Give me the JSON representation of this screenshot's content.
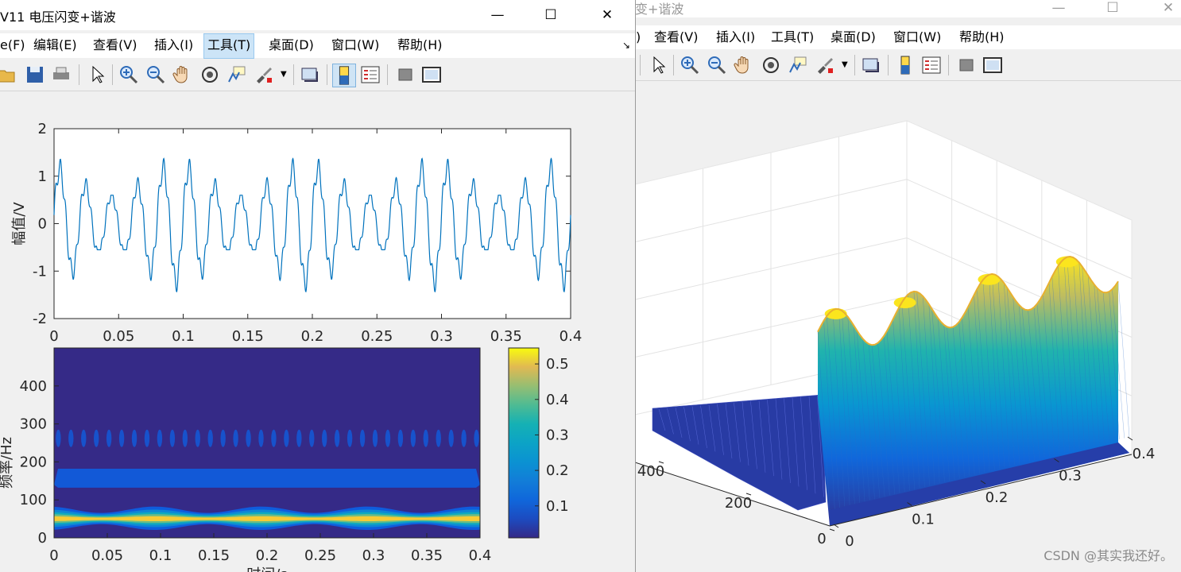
{
  "left_window": {
    "title": "V11 电压闪变+谐波",
    "controls": {
      "minimize": "—",
      "maximize": "☐",
      "close": "✕"
    },
    "menu": [
      "e(F)",
      "编辑(E)",
      "查看(V)",
      "插入(I)",
      "工具(T)",
      "桌面(D)",
      "窗口(W)",
      "帮助(H)"
    ],
    "active_menu": "工具(T)",
    "toolbar": [
      "open-icon",
      "save-icon",
      "print-icon",
      "pointer-icon",
      "zoom-in-icon",
      "zoom-out-icon",
      "pan-icon",
      "rotate-icon",
      "data-cursor-icon",
      "brush-icon",
      "link-icon",
      "colorbar-icon",
      "legend-icon",
      "hide-tools-icon",
      "dock-icon"
    ]
  },
  "right_window": {
    "title": "变+谐波",
    "controls": {
      "minimize": "—",
      "maximize": "☐",
      "close": "✕"
    },
    "menu": [
      ")",
      "查看(V)",
      "插入(I)",
      "工具(T)",
      "桌面(D)",
      "窗口(W)",
      "帮助(H)"
    ]
  },
  "watermark": "CSDN @其实我还好。",
  "colors": {
    "line": "#0072bd",
    "parula_low": "#352a87",
    "parula_high": "#f9fb0e"
  },
  "chart_data": [
    {
      "type": "line",
      "ylabel": "幅值/V",
      "xlim": [
        0,
        0.4
      ],
      "ylim": [
        -2,
        2
      ],
      "xticks": [
        "0",
        "0.05",
        "0.1",
        "0.15",
        "0.2",
        "0.25",
        "0.3",
        "0.35",
        "0.4"
      ],
      "yticks": [
        "-2",
        "-1",
        "0",
        "1",
        "2"
      ],
      "signal": {
        "fundamental_hz": 50,
        "amplitude_range": [
          0.55,
          1.25
        ],
        "flicker_period_s": 0.1,
        "harmonic_hz": 250
      }
    },
    {
      "type": "heatmap",
      "ylabel": "频率/Hz",
      "xlabel": "时间/s",
      "xlim": [
        0,
        0.4
      ],
      "ylim": [
        0,
        500
      ],
      "xticks": [
        "0",
        "0.05",
        "0.1",
        "0.15",
        "0.2",
        "0.25",
        "0.3",
        "0.35",
        "0.4"
      ],
      "yticks": [
        "0",
        "100",
        "200",
        "300",
        "400"
      ],
      "bands_hz": [
        50,
        150,
        250
      ],
      "colorbar_ticks": [
        "0.1",
        "0.2",
        "0.3",
        "0.4",
        "0.5"
      ]
    },
    {
      "type": "surface",
      "x_ticks": [
        "0",
        "0.1",
        "0.2",
        "0.3",
        "0.4"
      ],
      "y_ticks": [
        "0",
        "200",
        "400"
      ],
      "peaks_count": 4
    }
  ]
}
